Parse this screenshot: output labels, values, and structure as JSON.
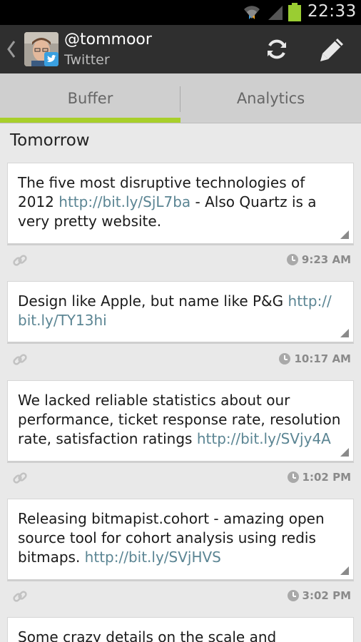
{
  "status_bar": {
    "time": "22:33",
    "icons": [
      "wifi-icon",
      "signal-icon",
      "battery-icon"
    ],
    "battery_color": "#9acd32"
  },
  "header": {
    "handle": "@tommoor",
    "service": "Twitter",
    "icons": [
      "back-chevron-icon",
      "refresh-icon",
      "compose-pencil-icon"
    ]
  },
  "tabs": [
    {
      "label": "Buffer",
      "selected": true
    },
    {
      "label": "Analytics",
      "selected": false
    }
  ],
  "accent_color": "#a8cf2a",
  "section": {
    "heading": "Tomorrow"
  },
  "posts": [
    {
      "text": "The five most disruptive technologies of 2012 ",
      "link": "http://bit.ly/SjL7ba",
      "suffix": " - Also Quartz is a very pretty website.",
      "time": "9:23 AM"
    },
    {
      "text": "Design like Apple, but name like P&G ",
      "link": "http://\nbit.ly/TY13hi",
      "suffix": "",
      "time": "10:17 AM"
    },
    {
      "text": "We lacked reliable statistics about our performance, ticket response rate, resolution rate, satisfaction ratings ",
      "link": "http://bit.ly/SVjy4A",
      "suffix": "",
      "time": "1:02 PM"
    },
    {
      "text": "Releasing bitmapist.cohort - amazing open source tool for cohort analysis using redis bitmaps. ",
      "link": "http://bit.ly/SVjHVS",
      "suffix": "",
      "time": "3:02 PM"
    },
    {
      "text": "Some crazy details on the scale and",
      "link": "",
      "suffix": "",
      "time": ""
    }
  ]
}
